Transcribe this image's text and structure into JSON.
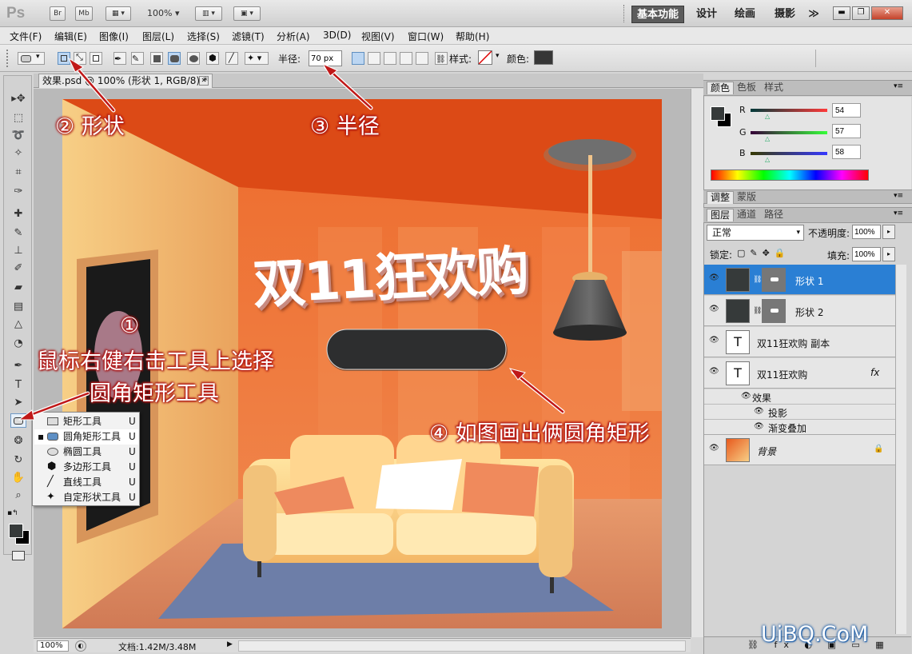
{
  "titlebar": {
    "logo": "Ps",
    "br": "Br",
    "mb": "Mb",
    "zoom": "100%",
    "workspaces": [
      "基本功能",
      "设计",
      "绘画",
      "摄影"
    ],
    "more": "≫"
  },
  "menu": [
    "文件(F)",
    "编辑(E)",
    "图像(I)",
    "图层(L)",
    "选择(S)",
    "滤镜(T)",
    "分析(A)",
    "3D(D)",
    "视图(V)",
    "窗口(W)",
    "帮助(H)"
  ],
  "options": {
    "radius_label": "半径:",
    "radius_value": "70 px",
    "style_label": "样式:",
    "color_label": "颜色:",
    "color": "#363636"
  },
  "document": {
    "tab_title": "效果.psd @ 100% (形状 1, RGB/8) *",
    "close": "✕",
    "zoom": "100%",
    "doc_size": "文档:1.42M/3.48M"
  },
  "canvas_text": {
    "headline": "双11狂欢购"
  },
  "annotations": {
    "a1_num": "①",
    "a1_line1": "鼠标右健右击工具上选择",
    "a1_line2": "圆角矩形工具",
    "a2": "② 形状",
    "a3": "③ 半径",
    "a4": "④ 如图画出俩圆角矩形"
  },
  "flyout": {
    "items": [
      {
        "label": "矩形工具",
        "key": "U",
        "icon": "rect"
      },
      {
        "label": "圆角矩形工具",
        "key": "U",
        "icon": "rounded-rect",
        "selected": true
      },
      {
        "label": "椭圆工具",
        "key": "U",
        "icon": "ellipse"
      },
      {
        "label": "多边形工具",
        "key": "U",
        "icon": "polygon"
      },
      {
        "label": "直线工具",
        "key": "U",
        "icon": "line"
      },
      {
        "label": "自定形状工具",
        "key": "U",
        "icon": "custom-shape"
      }
    ]
  },
  "color_panel": {
    "tabs": [
      "颜色",
      "色板",
      "样式"
    ],
    "r_label": "R",
    "g_label": "G",
    "b_label": "B",
    "r": "54",
    "g": "57",
    "b": "58",
    "fg": "#363a3a",
    "bg": "#000000"
  },
  "adjust_panel": {
    "tabs": [
      "调整",
      "蒙版"
    ]
  },
  "layers_panel": {
    "tabs": [
      "图层",
      "通道",
      "路径"
    ],
    "blend": "正常",
    "opacity_label": "不透明度:",
    "opacity": "100%",
    "lock_label": "锁定:",
    "fill_label": "填充:",
    "fill": "100%",
    "layers": [
      {
        "name": "形状 1",
        "type": "shape",
        "selected": true
      },
      {
        "name": "形状 2",
        "type": "shape"
      },
      {
        "name": "双11狂欢购 副本",
        "type": "text"
      },
      {
        "name": "双11狂欢购",
        "type": "text",
        "fx": "fx"
      },
      {
        "name": "背景",
        "type": "image",
        "lock": true
      }
    ],
    "effects": {
      "label": "效果",
      "items": [
        "投影",
        "渐变叠加"
      ]
    }
  },
  "watermark": "UiBQ.CoM",
  "colors": {
    "accent": "#2a7fd4",
    "annotation_red": "#c01818",
    "wall": "#f0a060",
    "ceiling": "#e85a1e"
  }
}
